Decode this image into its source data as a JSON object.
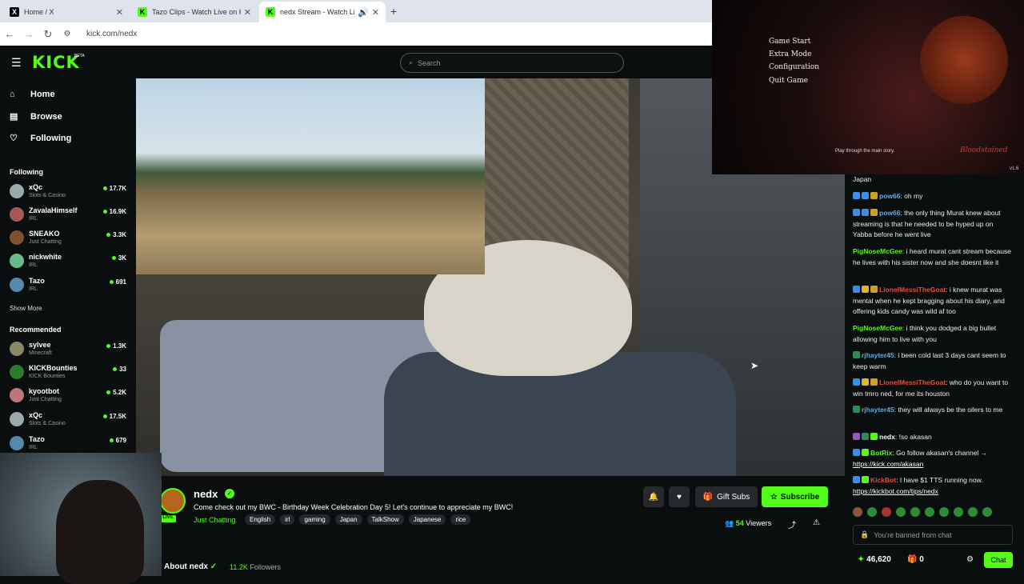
{
  "browser": {
    "tabs": [
      {
        "label": "Home / X",
        "icon": "x-logo-icon"
      },
      {
        "label": "Tazo Clips - Watch Live on Kick",
        "icon": "kick-logo-icon"
      },
      {
        "label": "nedx Stream - Watch Live o",
        "icon": "kick-logo-icon"
      }
    ],
    "url": "kick.com/nedx"
  },
  "header": {
    "logo": "KICK",
    "beta": "BETA",
    "search_placeholder": "Search"
  },
  "sidebar": {
    "nav": [
      {
        "label": "Home",
        "icon": "home-icon"
      },
      {
        "label": "Browse",
        "icon": "browse-icon"
      },
      {
        "label": "Following",
        "icon": "heart-icon"
      }
    ],
    "following_title": "Following",
    "following": [
      {
        "name": "xQc",
        "category": "Slots & Casino",
        "viewers": "17.7K"
      },
      {
        "name": "ZavalaHimself",
        "category": "IRL",
        "viewers": "16.9K"
      },
      {
        "name": "SNEAKO",
        "category": "Just Chatting",
        "viewers": "3.3K"
      },
      {
        "name": "nickwhite",
        "category": "IRL",
        "viewers": "3K"
      },
      {
        "name": "Tazo",
        "category": "IRL",
        "viewers": "691"
      }
    ],
    "show_more": "Show More",
    "recommended_title": "Recommended",
    "recommended": [
      {
        "name": "sylvee",
        "category": "Minecraft",
        "viewers": "1.3K"
      },
      {
        "name": "KICKBounties",
        "category": "KICK Bounties",
        "viewers": "33"
      },
      {
        "name": "kyootbot",
        "category": "Just Chatting",
        "viewers": "5.2K"
      },
      {
        "name": "xQc",
        "category": "Slots & Casino",
        "viewers": "17.5K"
      },
      {
        "name": "Tazo",
        "category": "IRL",
        "viewers": "679"
      }
    ]
  },
  "game_overlay": {
    "menu": [
      "Game Start",
      "Extra Mode",
      "Configuration",
      "Quit Game"
    ],
    "hint": "Play through the main story.",
    "logo": "Bloodstained",
    "version": "v1.6"
  },
  "chat": {
    "messages": [
      {
        "user": "",
        "text": "Japan",
        "color": "#ffffff"
      },
      {
        "user": "pow66",
        "text": ": oh my",
        "color": "#5dade2"
      },
      {
        "user": "pow66",
        "text": ": the only thing Murat knew about streaming is that he needed to be hyped up on Yabba before he went live",
        "color": "#5dade2"
      },
      {
        "user": "PigNoseMcGee",
        "text": ": i heard murat cant stream because he lives with his sister now and she doesnt like it",
        "color": "#53fc18"
      },
      {
        "user": "LionelMessiTheGoat",
        "text": ": i knew murat was mental when he kept bragging about his diary, and offering kids candy was wild af too",
        "color": "#e74c3c"
      },
      {
        "user": "PigNoseMcGee",
        "text": ": i think you dodged a big bullet allowing him to live with you",
        "color": "#53fc18"
      },
      {
        "user": "rjhayter45",
        "text": ": i been cold last 3 days cant seem to keep warm",
        "color": "#5dade2"
      },
      {
        "user": "LionelMessiTheGoat",
        "text": ": who do you want to win tmro ned, for me its houston",
        "color": "#e74c3c"
      },
      {
        "user": "rjhayter45",
        "text": ": they will always be the oilers to me",
        "color": "#5dade2"
      },
      {
        "user": "nedx",
        "text": ": !so akasan",
        "color": "#ffffff"
      },
      {
        "user": "BotRix",
        "text": ": Go follow akasan's channel → ",
        "link": "https://kick.com/akasan",
        "color": "#53fc18"
      },
      {
        "user": "KickBot",
        "text": ": I have $1 TTS running now. ",
        "link": "https://kickbot.com/tips/nedx",
        "color": "#e74c3c"
      }
    ],
    "banned_text": "You're banned from chat",
    "points": "46,620",
    "points2": "0",
    "chat_button": "Chat"
  },
  "stream": {
    "name": "nedx",
    "live": "LIVE",
    "title": "Come check out my BWC - Birthday Week Celebration Day 5! Let's continue to appreciate my BWC!",
    "category": "Just Chatting",
    "tags": [
      "English",
      "irl",
      "gaming",
      "Japan",
      "TalkShow",
      "Japanese",
      "rice"
    ],
    "gift_subs": "Gift Subs",
    "subscribe": "Subscribe",
    "viewers_count": "54",
    "viewers_label": "Viewers",
    "about_label": "About nedx",
    "followers_count": "11.2K",
    "followers_label": "Followers"
  },
  "colors": {
    "accent": "#53fc18",
    "background": "#0b0e0f"
  }
}
